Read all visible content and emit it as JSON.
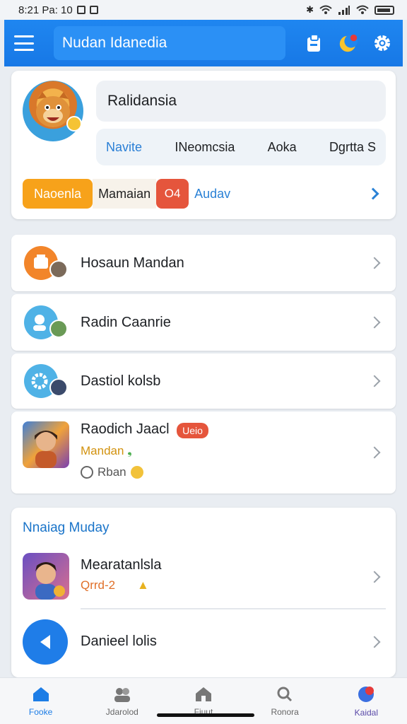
{
  "status_bar": {
    "time": "8:21 Pa: 10"
  },
  "app_bar": {
    "title": "Nudan Idanedia"
  },
  "profile": {
    "name": "Ralidansia",
    "tabs": [
      {
        "label": "Navite"
      },
      {
        "label": "INeomcsia"
      },
      {
        "label": "Aoka"
      },
      {
        "label": "Dgrtta S"
      }
    ],
    "chip_primary": "Naoenla",
    "chip_secondary": "Mamaian",
    "chip_count": "O4",
    "chip_link": "Audav"
  },
  "list": {
    "items": [
      {
        "label": "Hosaun Mandan"
      },
      {
        "label": "Radin Caanrie"
      },
      {
        "label": "Dastiol kolsb"
      },
      {
        "label": "Raodich Jaacl",
        "badge": "Ueio",
        "subtitle": "Mandan",
        "meta": "Rban"
      }
    ]
  },
  "section": {
    "title": "Nnaiag Muday",
    "items": [
      {
        "label": "Mearatanlsla",
        "subtitle": "Qrrd-2"
      },
      {
        "label": "Danieel lolis"
      }
    ]
  },
  "bottom_nav": {
    "items": [
      {
        "label": "Fooke"
      },
      {
        "label": "Jdarolod"
      },
      {
        "label": "Fiuut"
      },
      {
        "label": "Ronora"
      },
      {
        "label": "Kaidal"
      }
    ]
  },
  "colors": {
    "primary": "#1f86f0",
    "accent_orange": "#f7a21a",
    "accent_red": "#e5553c",
    "link_blue": "#2b82d6"
  }
}
